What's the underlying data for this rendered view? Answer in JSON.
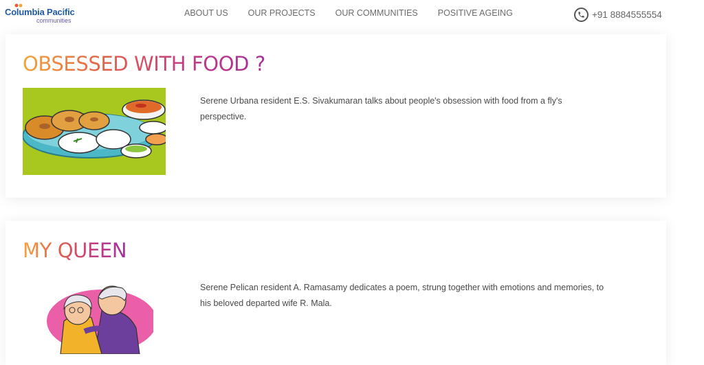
{
  "header": {
    "logo_text": "Columbia Pacific",
    "logo_sub": "communities",
    "nav": [
      {
        "label": "ABOUT US"
      },
      {
        "label": "OUR PROJECTS"
      },
      {
        "label": "OUR COMMUNITIES"
      },
      {
        "label": "POSITIVE AGEING"
      }
    ],
    "phone": "+91 8884555554",
    "phone_icon": "phone-icon"
  },
  "articles": [
    {
      "title": "OBSESSED WITH FOOD ?",
      "text": "Serene Urbana resident E.S. Sivakumaran talks about people's obsession with food from a fly's perspective.",
      "image": "food-illustration"
    },
    {
      "title": "MY QUEEN",
      "text": "Serene Pelican resident A. Ramasamy dedicates a poem, strung together with emotions and memories, to his beloved departed wife R. Mala.",
      "image": "elderly-couple-illustration"
    }
  ],
  "colors": {
    "title_gradient_start": "#f5a33c",
    "title_gradient_end": "#a4309a",
    "brand_blue": "#1f5aa6",
    "food_bg": "#a8c820"
  }
}
